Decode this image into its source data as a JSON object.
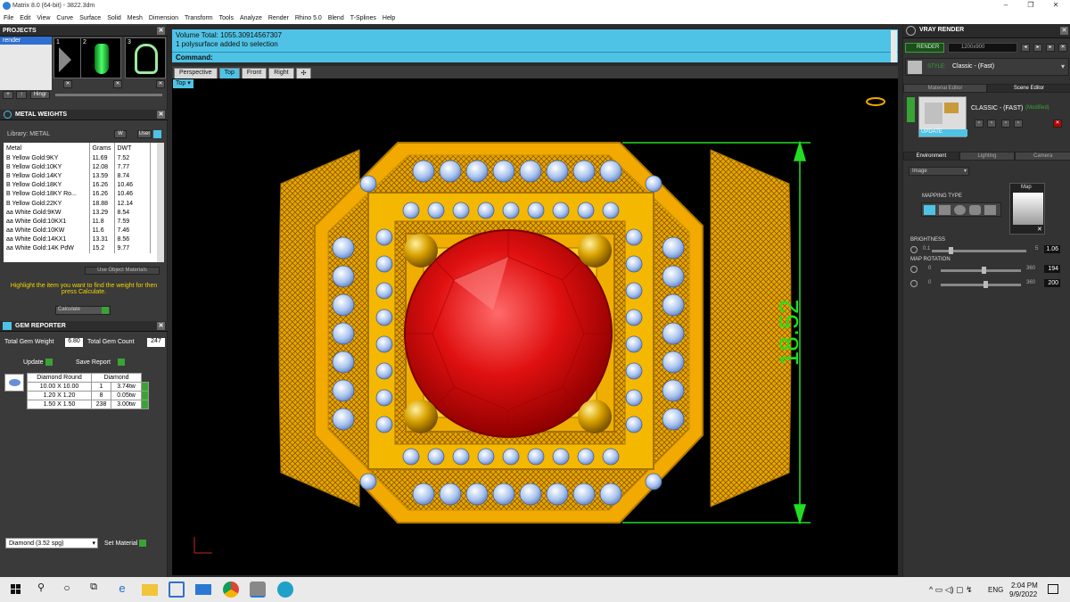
{
  "window": {
    "title": "Matrix 8.0 (64-bit) - 3822.3dm",
    "minimize": "–",
    "maximize": "❐",
    "close": "✕"
  },
  "menu": [
    "File",
    "Edit",
    "View",
    "Curve",
    "Surface",
    "Solid",
    "Mesh",
    "Dimension",
    "Transform",
    "Tools",
    "Analyze",
    "Render",
    "Rhino 5.0",
    "Blend",
    "T-Splines",
    "Help"
  ],
  "projects": {
    "title": "PROJECTS",
    "item": "render",
    "thumb_numbers": [
      "1",
      "2",
      "3"
    ],
    "thumb_buttons": [
      "✕",
      "✕",
      "✕"
    ],
    "toolbar": [
      "+",
      "↑",
      "Hingr"
    ]
  },
  "metal_weights": {
    "title": "METAL WEIGHTS",
    "library_label": "Library: METAL",
    "library_buttons": [
      "W",
      "User"
    ],
    "columns": [
      "Metal",
      "Grams",
      "DWT"
    ],
    "rows": [
      [
        "B Yellow Gold:9KY",
        "11.69",
        "7.52"
      ],
      [
        "B Yellow Gold:10KY",
        "12.08",
        "7.77"
      ],
      [
        "B Yellow Gold:14KY",
        "13.59",
        "8.74"
      ],
      [
        "B Yellow Gold:18KY",
        "16.26",
        "10.46"
      ],
      [
        "B Yellow Gold:18KY Ro...",
        "16.26",
        "10.46"
      ],
      [
        "B Yellow Gold:22KY",
        "18.88",
        "12.14"
      ],
      [
        "aa White Gold:9KW",
        "13.29",
        "8.54"
      ],
      [
        "aa White Gold:10KX1",
        "11.8",
        "7.59"
      ],
      [
        "aa White Gold:10KW",
        "11.6",
        "7.46"
      ],
      [
        "aa White Gold:14KX1",
        "13.31",
        "8.56"
      ],
      [
        "aa White Gold:14K PdW",
        "15.2",
        "9.77"
      ]
    ],
    "use_object_materials": "Use Object Materials",
    "hint": "Highlight the item you want to find the weight for then press Calculate.",
    "calculate": "Calculate"
  },
  "gem_reporter": {
    "title": "GEM REPORTER",
    "total_weight_label": "Total Gem Weight",
    "total_weight": "6.80",
    "total_count_label": "Total Gem Count",
    "total_count": "247",
    "update": "Update",
    "save_report": "Save Report",
    "columns": [
      "Diamond Round",
      "Diamond"
    ],
    "rows": [
      [
        "10.00 X 10.00",
        "1",
        "3.74tw"
      ],
      [
        "1.20 X 1.20",
        "8",
        "0.05tw"
      ],
      [
        "1.50 X 1.50",
        "238",
        "3.00tw"
      ]
    ],
    "material_select": "Diamond     (3.52 spg)",
    "set_material": "Set Material"
  },
  "info": {
    "line1": "Volume Total: 1055.30914567307",
    "line2": "1 polysurface added to selection",
    "command": "Command:"
  },
  "viewport_tabs": [
    "Perspective",
    "Top",
    "Front",
    "Right",
    "✣"
  ],
  "active_tab": "Top",
  "viewport_label": "Top",
  "dimension": "18.52",
  "vray": {
    "title": "VRAY RENDER",
    "render_btn": "RENDER",
    "resolution": "1200x900",
    "style_label": "STYLE:",
    "style_value": "Classic - (Fast)",
    "tabs1": [
      "Material Editor",
      "Scene Editor"
    ],
    "scene_name": "CLASSIC - (FAST)",
    "modified": "(Modified)",
    "update": "UPDATE",
    "tabs2": [
      "Environment",
      "Lighting",
      "Camera"
    ],
    "env_select": "Image",
    "mapping_type": "MAPPING TYPE",
    "map_label": "Map",
    "brightness": "BRIGHTNESS",
    "brightness_min": "0.1",
    "brightness_max": "5",
    "brightness_val": "1.06",
    "brightness_level": 0.19,
    "map_rotation": "MAP ROTATION",
    "rot_min": "0",
    "rot_max": "360",
    "rot1": "194",
    "rot2": "200",
    "rot1_level": 0.54,
    "rot2_level": 0.56
  },
  "taskbar": {
    "time": "2:04 PM",
    "date": "9/9/2022",
    "lang": "ENG"
  },
  "colors": {
    "accent": "#4fc3e6",
    "gold": "#f2a900",
    "ruby": "#e01010",
    "dim": "#22dd22"
  }
}
